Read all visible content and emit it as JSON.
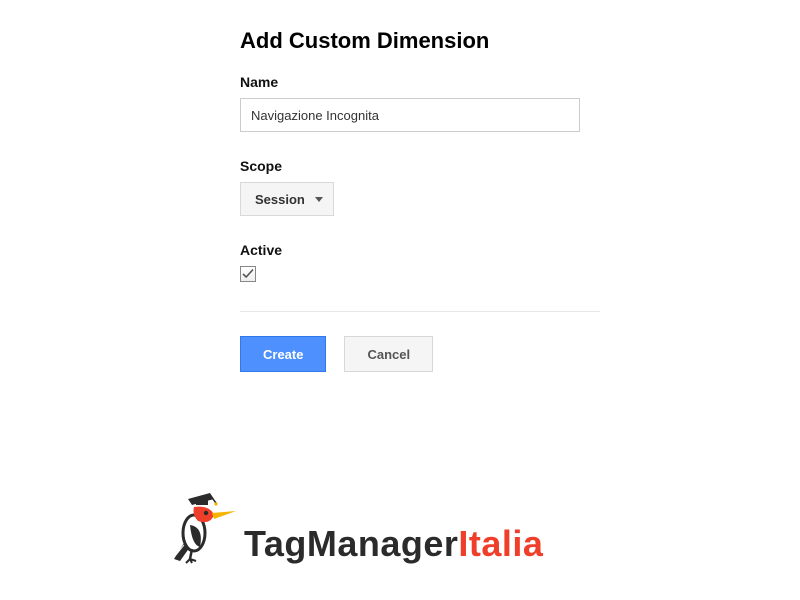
{
  "title": "Add Custom Dimension",
  "fields": {
    "name": {
      "label": "Name",
      "value": "Navigazione Incognita"
    },
    "scope": {
      "label": "Scope",
      "value": "Session"
    },
    "active": {
      "label": "Active",
      "checked": true
    }
  },
  "buttons": {
    "create": "Create",
    "cancel": "Cancel"
  },
  "logo": {
    "part1": "TagManager",
    "part2": "Italia"
  }
}
